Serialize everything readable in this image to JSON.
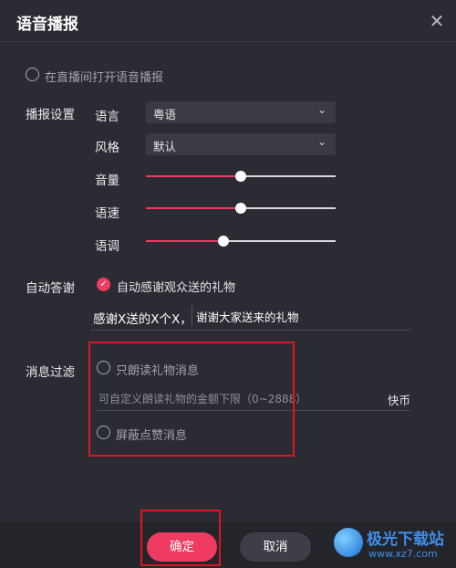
{
  "window": {
    "title": "语音播报",
    "close_icon": "close-icon"
  },
  "live_option": {
    "label": "在直播间打开语音播报",
    "checked": false
  },
  "broadcast": {
    "section_label": "播报设置",
    "language": {
      "label": "语言",
      "value": "粤语"
    },
    "style": {
      "label": "风格",
      "value": "默认"
    },
    "volume": {
      "label": "音量",
      "level": 0.5
    },
    "speed": {
      "label": "语速",
      "level": 0.5
    },
    "pitch": {
      "label": "语调",
      "level": 0.41
    }
  },
  "auto_thanks": {
    "section_label": "自动答谢",
    "checkbox_label": "自动感谢观众送的礼物",
    "checked": true,
    "prefix": "感谢X送的X个X，",
    "message": "谢谢大家送来的礼物"
  },
  "filter": {
    "section_label": "消息过滤",
    "gift_only_label": "只朗读礼物消息",
    "amount_placeholder": "可自定义朗读礼物的金额下限（0~2888）",
    "unit": "快币",
    "block_likes_label": "屏蔽点赞消息"
  },
  "buttons": {
    "ok": "确定",
    "cancel": "取消"
  },
  "watermark": {
    "name": "极光下载站",
    "url": "www.xz7.com"
  },
  "colors": {
    "accent": "#ef3b61",
    "highlight_box": "#e0141f",
    "background": "#2b2b33"
  }
}
